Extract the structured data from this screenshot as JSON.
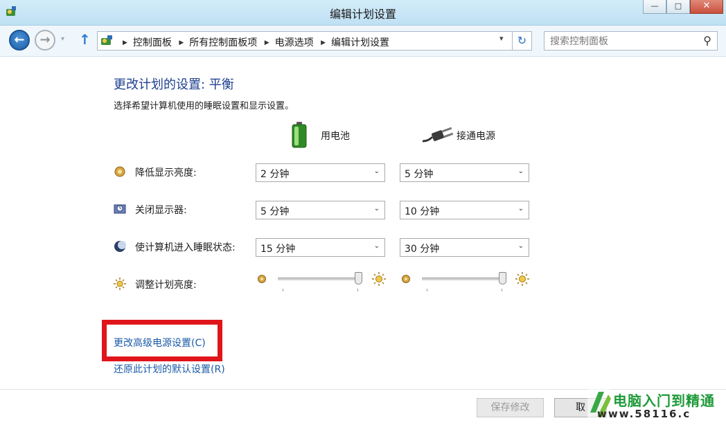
{
  "window": {
    "title": "编辑计划设置",
    "minimize_glyph": "—",
    "maximize_glyph": "□",
    "close_glyph": "✕"
  },
  "nav": {
    "back_glyph": "←",
    "forward_glyph": "→",
    "history_glyph": "▾",
    "up_glyph": "↑",
    "breadcrumbs": [
      "控制面板",
      "所有控制面板项",
      "电源选项",
      "编辑计划设置"
    ],
    "crumb_separator": "▶",
    "dropdown_glyph": "▾",
    "refresh_glyph": "↻",
    "search_placeholder": "搜索控制面板",
    "search_glyph": "⚲"
  },
  "page": {
    "heading": "更改计划的设置: 平衡",
    "description": "选择希望计算机使用的睡眠设置和显示设置。",
    "columns": {
      "battery": "用电池",
      "plugged_in": "接通电源"
    }
  },
  "settings": [
    {
      "label": "降低显示亮度:",
      "icon": "dim-display-icon",
      "battery": "2 分钟",
      "plugged": "5 分钟"
    },
    {
      "label": "关闭显示器:",
      "icon": "monitor-timer-icon",
      "battery": "5 分钟",
      "plugged": "10 分钟"
    },
    {
      "label": "使计算机进入睡眠状态:",
      "icon": "sleep-moon-icon",
      "battery": "15 分钟",
      "plugged": "30 分钟"
    }
  ],
  "brightness": {
    "label": "调整计划亮度:",
    "battery_level": 1.0,
    "plugged_level": 1.0
  },
  "dropdown_caret": "⌄",
  "links": {
    "advanced": "更改高级电源设置(C)",
    "restore": "还原此计划的默认设置(R)"
  },
  "buttons": {
    "save": "保存修改",
    "cancel": "取"
  },
  "watermark": {
    "text": "电脑入门到精通",
    "url": "www.58116.c"
  },
  "colors": {
    "accent": "#1e3f8f",
    "link": "#1a5aa8",
    "highlight_box": "#e0151b",
    "battery_green": "#4caf3a"
  }
}
